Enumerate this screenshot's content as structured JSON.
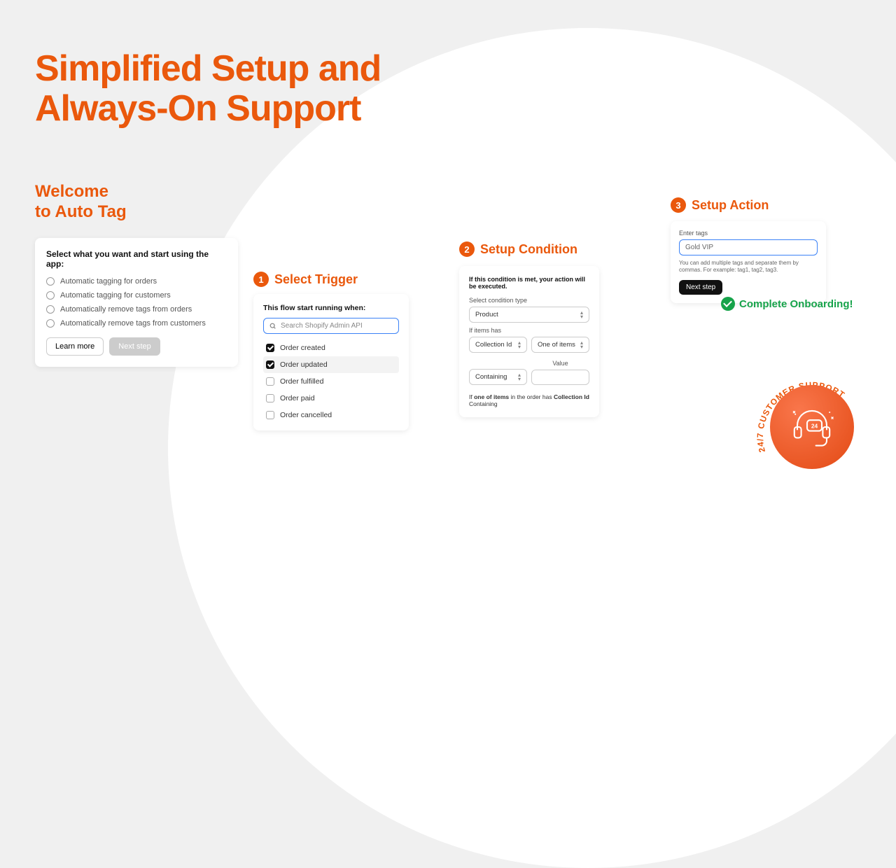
{
  "headline_line1": "Simplified Setup and",
  "headline_line2": "Always-On Support",
  "welcome_line1": "Welcome",
  "welcome_line2": "to Auto Tag",
  "welcome_card": {
    "title": "Select what you want and start using the app:",
    "options": [
      "Automatic tagging for orders",
      "Automatic tagging for customers",
      "Automatically remove tags from orders",
      "Automatically remove tags from customers"
    ],
    "learn_more": "Learn more",
    "next_step": "Next step"
  },
  "step1": {
    "num": "1",
    "title": "Select Trigger",
    "subhead": "This flow start running when:",
    "search_placeholder": "Search Shopify Admin API",
    "options": [
      "Order created",
      "Order updated",
      "Order fulfilled",
      "Order paid",
      "Order cancelled"
    ]
  },
  "step2": {
    "num": "2",
    "title": "Setup Condition",
    "header": "If this condition is met, your action will be executed.",
    "label_type": "Select condition type",
    "val_type": "Product",
    "label_items": "If items has",
    "val_field": "Collection Id",
    "val_mode": "One of items",
    "val_op": "Containing",
    "label_value": "Value",
    "summary_prefix": "If ",
    "summary_bold1": "one of items",
    "summary_mid": " in the order has ",
    "summary_bold2": "Collection Id",
    "summary_end": " Containing"
  },
  "step3": {
    "num": "3",
    "title": "Setup Action",
    "label": "Enter tags",
    "value": "Gold VIP",
    "hint": "You can add multiple tags and separate them by commas. For example: tag1, tag2, tag3.",
    "next": "Next step"
  },
  "complete": "Complete Onboarding!",
  "support_text": "24/7 CUSTOMER SUPPORT"
}
